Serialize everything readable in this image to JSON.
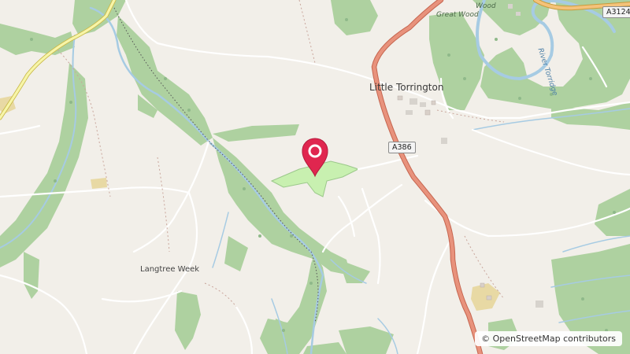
{
  "map": {
    "places": {
      "little_torrington": "Little Torrington",
      "langtree_week": "Langtree Week"
    },
    "woods": {
      "great_wood": "Great Wood",
      "wood_top": "Wood"
    },
    "rivers": {
      "river_torridge": "River Torridge"
    },
    "roads": {
      "a386": "A386",
      "a3124": "A3124"
    },
    "attribution": "© OpenStreetMap contributors",
    "marker_icon": "map-pin-icon",
    "colors": {
      "land": "#f2efe9",
      "forest": "#aed1a0",
      "primary_road": "#e8927c",
      "secondary_road": "#f7f5a8",
      "water": "#a6cbe3",
      "marker": "#e0264f",
      "park": "#c8f0b0"
    }
  }
}
